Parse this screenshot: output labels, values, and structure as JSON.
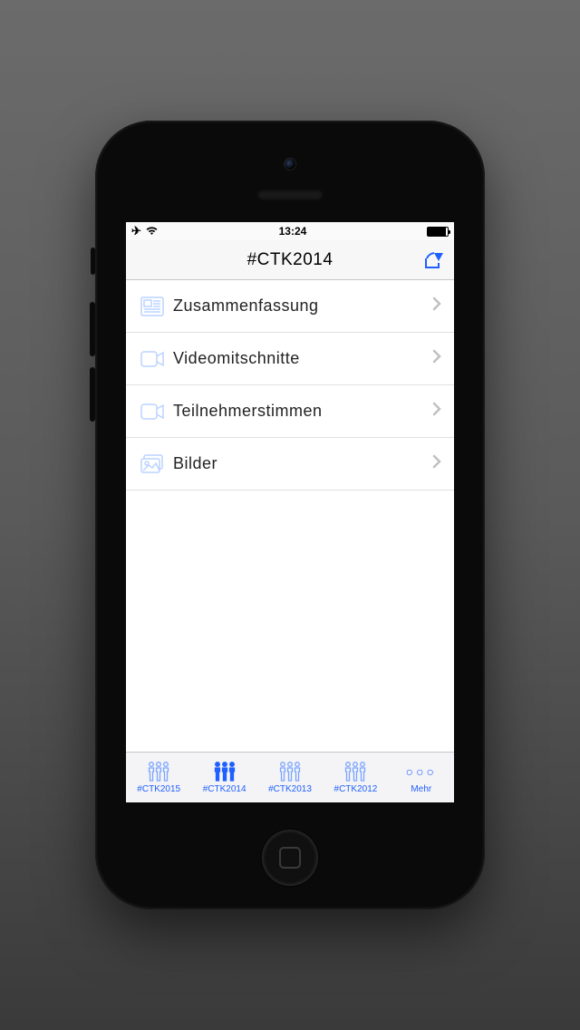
{
  "status": {
    "time": "13:24"
  },
  "nav": {
    "title": "#CTK2014"
  },
  "menu": [
    {
      "label": "Zusammenfassung",
      "icon": "news-icon"
    },
    {
      "label": "Videomitschnitte",
      "icon": "video-icon"
    },
    {
      "label": "Teilnehmerstimmen",
      "icon": "video-icon"
    },
    {
      "label": "Bilder",
      "icon": "images-icon"
    }
  ],
  "tabs": [
    {
      "label": "#CTK2015",
      "active": false
    },
    {
      "label": "#CTK2014",
      "active": true
    },
    {
      "label": "#CTK2013",
      "active": false
    },
    {
      "label": "#CTK2012",
      "active": false
    },
    {
      "label": "Mehr",
      "active": false,
      "more": true
    }
  ]
}
